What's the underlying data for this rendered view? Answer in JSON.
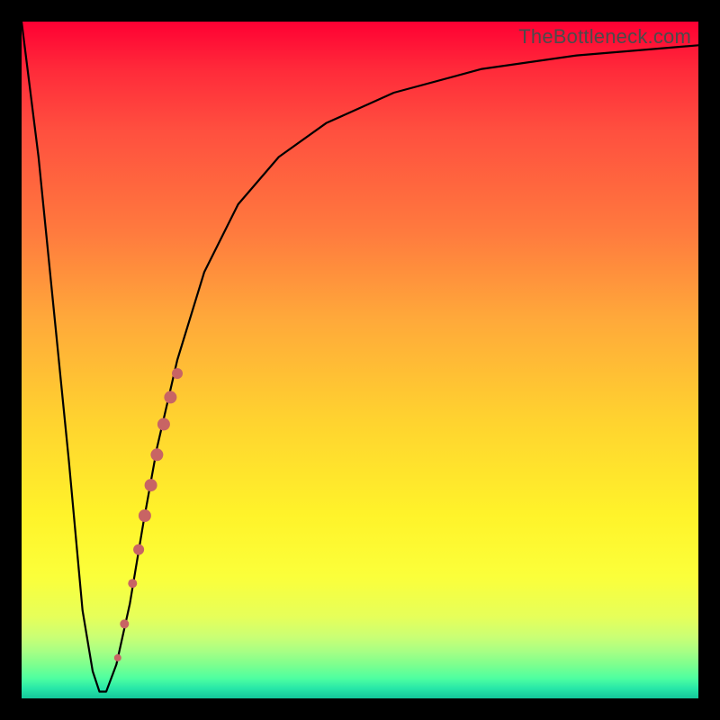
{
  "watermark": "TheBottleneck.com",
  "chart_data": {
    "type": "line",
    "title": "",
    "xlabel": "",
    "ylabel": "",
    "xlim": [
      0,
      100
    ],
    "ylim": [
      0,
      100
    ],
    "background_gradient": {
      "top": "#ff0033",
      "mid": "#ffd32f",
      "bottom": "#14c79a"
    },
    "series": [
      {
        "name": "bottleneck-curve",
        "x": [
          0.0,
          2.5,
          5.0,
          7.0,
          9.0,
          10.5,
          11.5,
          12.5,
          14.0,
          16.0,
          18.0,
          20.0,
          23.0,
          27.0,
          32.0,
          38.0,
          45.0,
          55.0,
          68.0,
          82.0,
          100.0
        ],
        "y": [
          100,
          80,
          55,
          35,
          13,
          4,
          1,
          1,
          5,
          14,
          26,
          37,
          50,
          63,
          73,
          80,
          85,
          89.5,
          93,
          95,
          96.5
        ]
      }
    ],
    "markers": {
      "name": "highlight-dots",
      "color": "#c86464",
      "points": [
        {
          "x": 14.2,
          "y": 6.0,
          "r": 4
        },
        {
          "x": 15.2,
          "y": 11.0,
          "r": 5
        },
        {
          "x": 16.4,
          "y": 17.0,
          "r": 5
        },
        {
          "x": 17.3,
          "y": 22.0,
          "r": 6
        },
        {
          "x": 18.2,
          "y": 27.0,
          "r": 7
        },
        {
          "x": 19.1,
          "y": 31.5,
          "r": 7
        },
        {
          "x": 20.0,
          "y": 36.0,
          "r": 7
        },
        {
          "x": 21.0,
          "y": 40.5,
          "r": 7
        },
        {
          "x": 22.0,
          "y": 44.5,
          "r": 7
        },
        {
          "x": 23.0,
          "y": 48.0,
          "r": 6
        }
      ]
    }
  }
}
